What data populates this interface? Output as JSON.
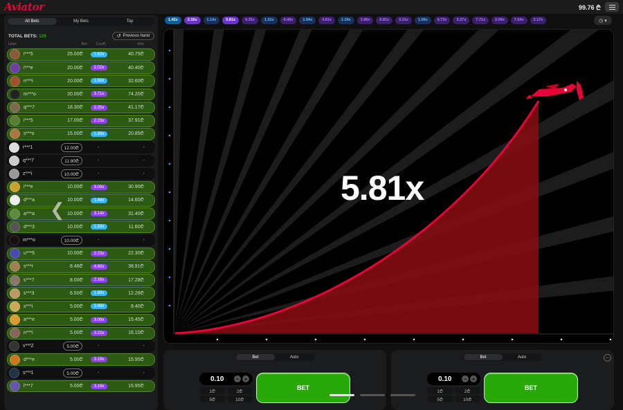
{
  "app": {
    "logo": "Aviator",
    "balance": "99.76 ₾",
    "menu_icon": "hamburger-icon"
  },
  "sidebar": {
    "tabs": [
      {
        "label": "All Bets",
        "active": true
      },
      {
        "label": "My Bets",
        "active": false
      },
      {
        "label": "Top",
        "active": false
      }
    ],
    "total_label": "TOTAL BETS:",
    "total_value": "125",
    "previous_hand": "Previous hand",
    "columns": [
      "User",
      "Bet",
      "Coeff.",
      "Win"
    ],
    "rows": [
      {
        "user": "i***5",
        "bet": "25.00₾",
        "coeff": "1.63x",
        "win": "40.75₾",
        "won": true,
        "color": "#34b4ff"
      },
      {
        "user": "i***e",
        "bet": "20.00₾",
        "coeff": "2.02x",
        "win": "40.40₾",
        "won": true,
        "color": "#913ef8"
      },
      {
        "user": "n***i",
        "bet": "20.00₾",
        "coeff": "1.63x",
        "win": "32.60₾",
        "won": true,
        "color": "#34b4ff"
      },
      {
        "user": "m***o",
        "bet": "20.00₾",
        "coeff": "3.71x",
        "win": "74.20₾",
        "won": true,
        "color": "#913ef8"
      },
      {
        "user": "q***7",
        "bet": "18.30₾",
        "coeff": "2.25x",
        "win": "41.17₾",
        "won": true,
        "color": "#913ef8"
      },
      {
        "user": "i***5",
        "bet": "17.00₾",
        "coeff": "2.23x",
        "win": "37.91₾",
        "won": true,
        "color": "#913ef8"
      },
      {
        "user": "s***o",
        "bet": "15.00₾",
        "coeff": "1.39x",
        "win": "20.85₾",
        "won": true,
        "color": "#34b4ff"
      },
      {
        "user": "r***1",
        "bet": "12.00₾",
        "coeff": "-",
        "win": "-",
        "won": false,
        "color": ""
      },
      {
        "user": "q***7",
        "bet": "11.90₾",
        "coeff": "-",
        "win": "-",
        "won": false,
        "color": ""
      },
      {
        "user": "z***i",
        "bet": "10.00₾",
        "coeff": "-",
        "win": "-",
        "won": false,
        "color": ""
      },
      {
        "user": "i***e",
        "bet": "10.00₾",
        "coeff": "3.09x",
        "win": "30.90₾",
        "won": true,
        "color": "#913ef8"
      },
      {
        "user": "d***a",
        "bet": "10.00₾",
        "coeff": "1.46x",
        "win": "14.60₾",
        "won": true,
        "color": "#34b4ff"
      },
      {
        "user": "a***a",
        "bet": "10.00₾",
        "coeff": "3.14x",
        "win": "31.40₾",
        "won": true,
        "color": "#913ef8"
      },
      {
        "user": "d***3",
        "bet": "10.00₾",
        "coeff": "1.16x",
        "win": "11.60₾",
        "won": true,
        "color": "#34b4ff"
      },
      {
        "user": "m***o",
        "bet": "10.00₾",
        "coeff": "-",
        "win": "-",
        "won": false,
        "color": ""
      },
      {
        "user": "u***5",
        "bet": "10.00₾",
        "coeff": "2.23x",
        "win": "22.30₾",
        "won": true,
        "color": "#913ef8"
      },
      {
        "user": "s***r",
        "bet": "8.46₾",
        "coeff": "4.60x",
        "win": "38.91₾",
        "won": true,
        "color": "#913ef8"
      },
      {
        "user": "s***7",
        "bet": "8.00₾",
        "coeff": "2.16x",
        "win": "17.28₾",
        "won": true,
        "color": "#913ef8"
      },
      {
        "user": "s***3",
        "bet": "6.50₾",
        "coeff": "1.89x",
        "win": "12.28₾",
        "won": true,
        "color": "#34b4ff"
      },
      {
        "user": "s***i",
        "bet": "5.00₾",
        "coeff": "1.68x",
        "win": "8.40₾",
        "won": true,
        "color": "#34b4ff"
      },
      {
        "user": "a***e",
        "bet": "5.00₾",
        "coeff": "3.09x",
        "win": "15.45₾",
        "won": true,
        "color": "#913ef8"
      },
      {
        "user": "n***i",
        "bet": "5.00₾",
        "coeff": "3.22x",
        "win": "16.10₾",
        "won": true,
        "color": "#913ef8"
      },
      {
        "user": "v***2",
        "bet": "5.00₾",
        "coeff": "-",
        "win": "-",
        "won": false,
        "color": ""
      },
      {
        "user": "d***e",
        "bet": "5.00₾",
        "coeff": "3.19x",
        "win": "15.95₾",
        "won": true,
        "color": "#913ef8"
      },
      {
        "user": "s***1",
        "bet": "5.00₾",
        "coeff": "-",
        "win": "-",
        "won": false,
        "color": ""
      },
      {
        "user": "l***7",
        "bet": "5.00₾",
        "coeff": "3.19x",
        "win": "15.95₾",
        "won": true,
        "color": "#913ef8"
      }
    ]
  },
  "history": [
    {
      "v": "1.42x",
      "c": "#34b4ff"
    },
    {
      "v": "2.16x",
      "c": "#913ef8"
    },
    {
      "v": "1.14x",
      "c": "#34b4ff"
    },
    {
      "v": "5.81x",
      "c": "#913ef8"
    },
    {
      "v": "9.35x",
      "c": "#913ef8"
    },
    {
      "v": "1.31x",
      "c": "#34b4ff"
    },
    {
      "v": "6.48x",
      "c": "#913ef8"
    },
    {
      "v": "1.94x",
      "c": "#34b4ff"
    },
    {
      "v": "4.81x",
      "c": "#913ef8"
    },
    {
      "v": "1.24x",
      "c": "#34b4ff"
    },
    {
      "v": "3.96x",
      "c": "#913ef8"
    },
    {
      "v": "6.81x",
      "c": "#913ef8"
    },
    {
      "v": "2.21x",
      "c": "#913ef8"
    },
    {
      "v": "1.56x",
      "c": "#34b4ff"
    },
    {
      "v": "6.73x",
      "c": "#913ef8"
    },
    {
      "v": "3.27x",
      "c": "#913ef8"
    },
    {
      "v": "7.71x",
      "c": "#913ef8"
    },
    {
      "v": "2.09x",
      "c": "#913ef8"
    },
    {
      "v": "7.54x",
      "c": "#913ef8"
    },
    {
      "v": "2.17x",
      "c": "#913ef8"
    }
  ],
  "history_button_icon": "clock-icon",
  "game": {
    "multiplier": "5.81x",
    "curve_color": "#e50539"
  },
  "panels": [
    {
      "tabs": [
        "Bet",
        "Auto"
      ],
      "stake": "0.10",
      "quick": [
        "1₾",
        "2₾",
        "5₾",
        "10₾"
      ],
      "bet_label": "BET"
    },
    {
      "tabs": [
        "Bet",
        "Auto"
      ],
      "stake": "0.10",
      "quick": [
        "1₾",
        "2₾",
        "5₾",
        "10₾"
      ],
      "bet_label": "BET"
    }
  ]
}
